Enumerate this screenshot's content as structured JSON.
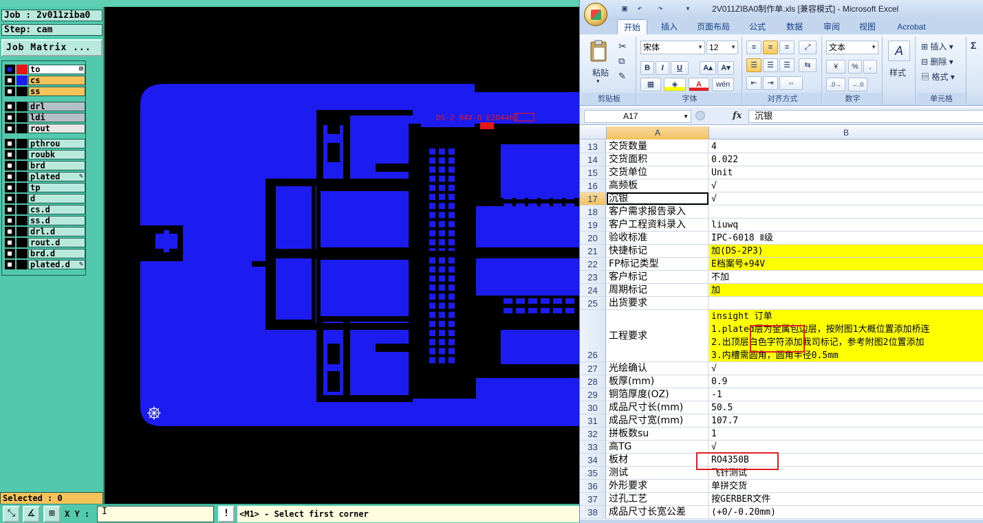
{
  "cam": {
    "job_label": "Job : 2v011ziba0",
    "step_label": "Step: cam",
    "job_matrix_label": "Job Matrix ...",
    "layers": [
      {
        "name": "to",
        "color": "#ffffff",
        "swatch": "#e41818",
        "check": "blue",
        "mark": "⊞"
      },
      {
        "name": "cs",
        "color": "#f6c25a",
        "swatch": "#1c1cf0",
        "check": "",
        "mark": ""
      },
      {
        "name": "ss",
        "color": "#f6c25a",
        "swatch": "#000000",
        "check": "",
        "mark": ""
      },
      {
        "name": "drl",
        "color": "#b5bfc6",
        "swatch": "#000000",
        "check": "",
        "mark": ""
      },
      {
        "name": "ldi",
        "color": "#b5bfc6",
        "swatch": "#000000",
        "check": "",
        "mark": ""
      },
      {
        "name": "rout",
        "color": "#e6e6e6",
        "swatch": "#000000",
        "check": "",
        "mark": ""
      },
      {
        "name": "pthrou",
        "color": "#b9e8dc",
        "swatch": "#000000",
        "check": "",
        "mark": ""
      },
      {
        "name": "roubk",
        "color": "#b9e8dc",
        "swatch": "#000000",
        "check": "",
        "mark": ""
      },
      {
        "name": "brd",
        "color": "#b9e8dc",
        "swatch": "#000000",
        "check": "",
        "mark": ""
      },
      {
        "name": "plated",
        "color": "#b9e8dc",
        "swatch": "#000000",
        "check": "",
        "mark": "✎"
      },
      {
        "name": "tp",
        "color": "#b9e8dc",
        "swatch": "#000000",
        "check": "",
        "mark": ""
      },
      {
        "name": "d",
        "color": "#b9e8dc",
        "swatch": "#000000",
        "check": "",
        "mark": ""
      },
      {
        "name": "cs.d",
        "color": "#b9e8dc",
        "swatch": "#000000",
        "check": "",
        "mark": ""
      },
      {
        "name": "ss.d",
        "color": "#b9e8dc",
        "swatch": "#000000",
        "check": "",
        "mark": ""
      },
      {
        "name": "drl.d",
        "color": "#b9e8dc",
        "swatch": "#000000",
        "check": "",
        "mark": ""
      },
      {
        "name": "rout.d",
        "color": "#b9e8dc",
        "swatch": "#000000",
        "check": "",
        "mark": ""
      },
      {
        "name": "brd.d",
        "color": "#b9e8dc",
        "swatch": "#000000",
        "check": "",
        "mark": ""
      },
      {
        "name": "plated.d",
        "color": "#b9e8dc",
        "swatch": "#000000",
        "check": "",
        "mark": "✎"
      }
    ],
    "selected_label": "Selected : 0",
    "xy_label": "X Y :",
    "xy_value": "I",
    "warn_label": "!",
    "prompt": "<M1> - Select first corner",
    "board_marking": "DS-2 94V-0 E204460",
    "board_color": "#1c1cf0",
    "marking_color": "#e41818"
  },
  "excel": {
    "title": "2V011ZIBA0制作单.xls  [兼容模式] - Microsoft Excel",
    "tabs": [
      "开始",
      "插入",
      "页面布局",
      "公式",
      "数据",
      "审阅",
      "视图",
      "Acrobat"
    ],
    "ribbon": {
      "paste_label": "粘贴",
      "font_name": "宋体",
      "font_size": "12",
      "number_format": "文本",
      "style_label": "样式",
      "insert_label": "插入",
      "delete_label": "删除",
      "format_label": "格式",
      "groups": [
        "剪贴板",
        "字体",
        "对齐方式",
        "数字",
        "单元格"
      ]
    },
    "name_box": "A17",
    "fx": "fx",
    "formula_value": "沉银",
    "columns": [
      "A",
      "B"
    ],
    "rows": [
      {
        "num": "13",
        "a": "交货数量",
        "b": [
          "4"
        ],
        "yellow": false
      },
      {
        "num": "14",
        "a": "交货面积",
        "b": [
          "0.022"
        ],
        "yellow": false
      },
      {
        "num": "15",
        "a": "交货单位",
        "b": [
          "Unit"
        ],
        "yellow": false
      },
      {
        "num": "16",
        "a": "高频板",
        "b": [
          "√"
        ],
        "yellow": false
      },
      {
        "num": "17",
        "a": "沉银",
        "b": [
          "√"
        ],
        "yellow": false,
        "active": true
      },
      {
        "num": "18",
        "a": "客户需求报告录入",
        "b": [
          ""
        ],
        "yellow": false
      },
      {
        "num": "19",
        "a": "客户工程资料录入",
        "b": [
          "liuwq"
        ],
        "yellow": false
      },
      {
        "num": "20",
        "a": "验收标准",
        "b": [
          "IPC-6018 Ⅱ级"
        ],
        "yellow": false
      },
      {
        "num": "21",
        "a": "快捷标记",
        "b": [
          "加(DS-2P3)"
        ],
        "yellow": true
      },
      {
        "num": "22",
        "a": "FP标记类型",
        "b": [
          "E档案号+94V"
        ],
        "yellow": true
      },
      {
        "num": "23",
        "a": "客户标记",
        "b": [
          "不加"
        ],
        "yellow": false
      },
      {
        "num": "24",
        "a": "周期标记",
        "b": [
          "加"
        ],
        "yellow": true
      },
      {
        "num": "25",
        "a": "出货要求",
        "b": [
          ""
        ],
        "yellow": false
      },
      {
        "num": "26",
        "a": "工程要求",
        "b": [
          "insight 订单",
          "1.plated层为金属包边层，按附图1大概位置添加桥连",
          "2.出顶层白色字符添加我司标记，参考附图2位置添加",
          "3.内槽需圆角，圆角半径0.5mm"
        ],
        "yellow": true,
        "tall": true
      },
      {
        "num": "27",
        "a": "光绘确认",
        "b": [
          "√"
        ],
        "yellow": false
      },
      {
        "num": "28",
        "a": "板厚(mm)",
        "b": [
          "0.9"
        ],
        "yellow": false
      },
      {
        "num": "29",
        "a": "铜箔厚度(OZ)",
        "b": [
          "-1"
        ],
        "yellow": false
      },
      {
        "num": "30",
        "a": "成品尺寸长(mm)",
        "b": [
          "50.5"
        ],
        "yellow": false
      },
      {
        "num": "31",
        "a": "成品尺寸宽(mm)",
        "b": [
          "107.7"
        ],
        "yellow": false
      },
      {
        "num": "32",
        "a": "拼板数su",
        "b": [
          "1"
        ],
        "yellow": false
      },
      {
        "num": "33",
        "a": "高TG",
        "b": [
          "√"
        ],
        "yellow": false
      },
      {
        "num": "34",
        "a": "板材",
        "b": [
          "RO4350B"
        ],
        "yellow": false
      },
      {
        "num": "35",
        "a": "测试",
        "b": [
          "飞针测试"
        ],
        "yellow": false
      },
      {
        "num": "36",
        "a": "外形要求",
        "b": [
          "单拼交货"
        ],
        "yellow": false
      },
      {
        "num": "37",
        "a": "过孔工艺",
        "b": [
          "按GERBER文件"
        ],
        "yellow": false
      },
      {
        "num": "38",
        "a": "成品尺寸长宽公差",
        "b": [
          "(+0/-0.20mm)"
        ],
        "yellow": false
      }
    ]
  }
}
